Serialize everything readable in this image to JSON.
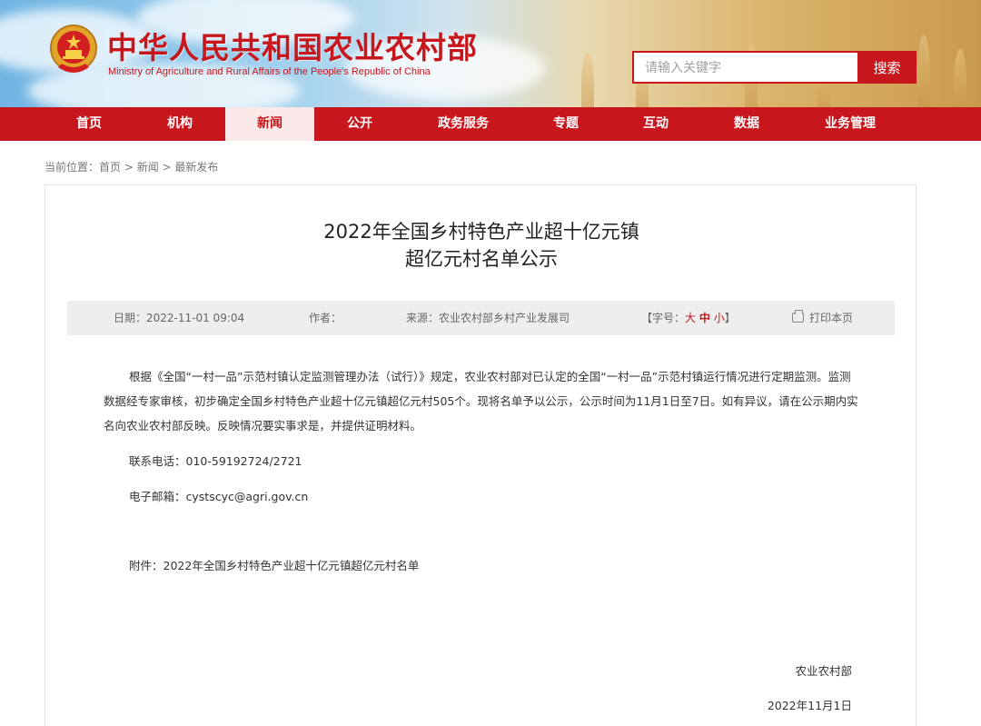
{
  "header": {
    "site_title": "中华人民共和国农业农村部",
    "site_subtitle": "Ministry of Agriculture and Rural Affairs of the People's Republic of China",
    "brand_color": "#c8161d",
    "emblem_icon": "national-emblem-icon"
  },
  "search": {
    "placeholder": "请输入关键字",
    "button_label": "搜索"
  },
  "nav": {
    "items": [
      {
        "label": "首页"
      },
      {
        "label": "机构"
      },
      {
        "label": "新闻",
        "active": true
      },
      {
        "label": "公开"
      },
      {
        "label": "政务服务"
      },
      {
        "label": "专题"
      },
      {
        "label": "互动"
      },
      {
        "label": "数据"
      },
      {
        "label": "业务管理"
      }
    ]
  },
  "breadcrumb": {
    "prefix": "当前位置：",
    "items": [
      "首页",
      "新闻",
      "最新发布"
    ],
    "separator": " > "
  },
  "article": {
    "title_line1": "2022年全国乡村特色产业超十亿元镇",
    "title_line2": "超亿元村名单公示",
    "meta": {
      "date": "日期：2022-11-01 09:04",
      "author": "作者：",
      "source": "来源：农业农村部乡村产业发展司",
      "font_size_label": "【字号：",
      "font_size_large": "大",
      "font_size_medium": "中",
      "font_size_small": "小",
      "font_size_end": "】",
      "print_label": "打印本页",
      "print_icon": "printer-icon"
    },
    "paragraph1": "根据《全国“一村一品”示范村镇认定监测管理办法（试行）》规定，农业农村部对已认定的全国“一村一品”示范村镇运行情况进行定期监测。监测数据经专家审核，初步确定全国乡村特色产业超十亿元镇超亿元村505个。现将名单予以公示，公示时间为11月1日至7日。如有异议，请在公示期内实名向农业农村部反映。反映情况要实事求是，并提供证明材料。",
    "phone": "联系电话：010-59192724/2721",
    "email_label": "电子邮箱：",
    "email": "cystscyc@agri.gov.cn",
    "attachment_label": "附件：",
    "attachment_link": "2022年全国乡村特色产业超十亿元镇超亿元村名单",
    "signature_org": "农业农村部",
    "signature_date": "2022年11月1日"
  }
}
